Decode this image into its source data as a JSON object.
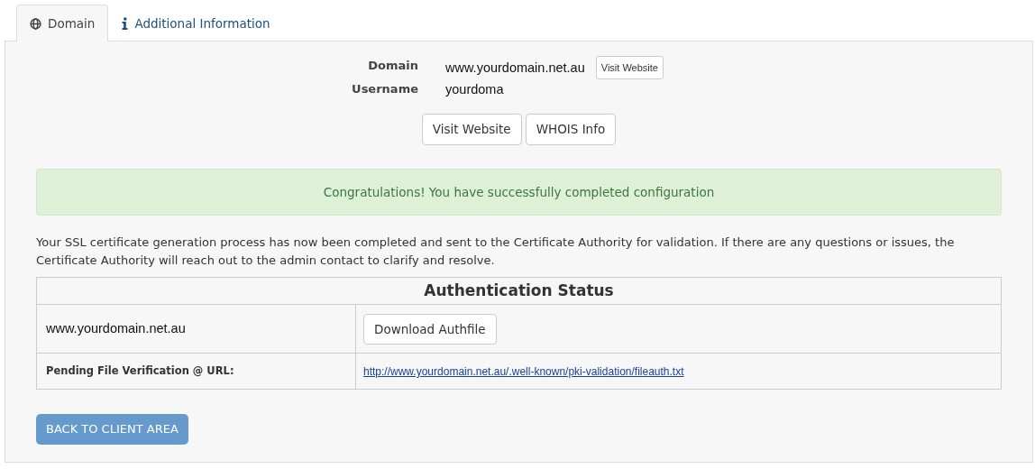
{
  "tabs": [
    {
      "label": "Domain",
      "selected": true
    },
    {
      "label": "Additional Information",
      "selected": false
    }
  ],
  "details": [
    {
      "label": "Domain",
      "value": "www.yourdomain.net.au",
      "button": "Visit Website"
    },
    {
      "label": "Username",
      "value": "yourdoma"
    }
  ],
  "action_buttons": [
    "Visit Website",
    "WHOIS Info"
  ],
  "alert": "Congratulations! You have successfully completed configuration",
  "message": "Your SSL certificate generation process has now been completed and sent to the Certificate Authority for validation. If there are any questions or issues, the Certificate Authority will reach out to the admin contact to clarify and resolve.",
  "auth_table": {
    "title": "Authentication Status",
    "rows": [
      {
        "kind": "button",
        "label": "www.yourdomain.net.au",
        "button": "Download Authfile"
      },
      {
        "kind": "link",
        "label": "Pending File Verification @ URL:",
        "link": "http://www.yourdomain.net.au/.well-known/pki-validation/fileauth.txt"
      }
    ]
  },
  "back_button": "BACK TO CLIENT AREA"
}
